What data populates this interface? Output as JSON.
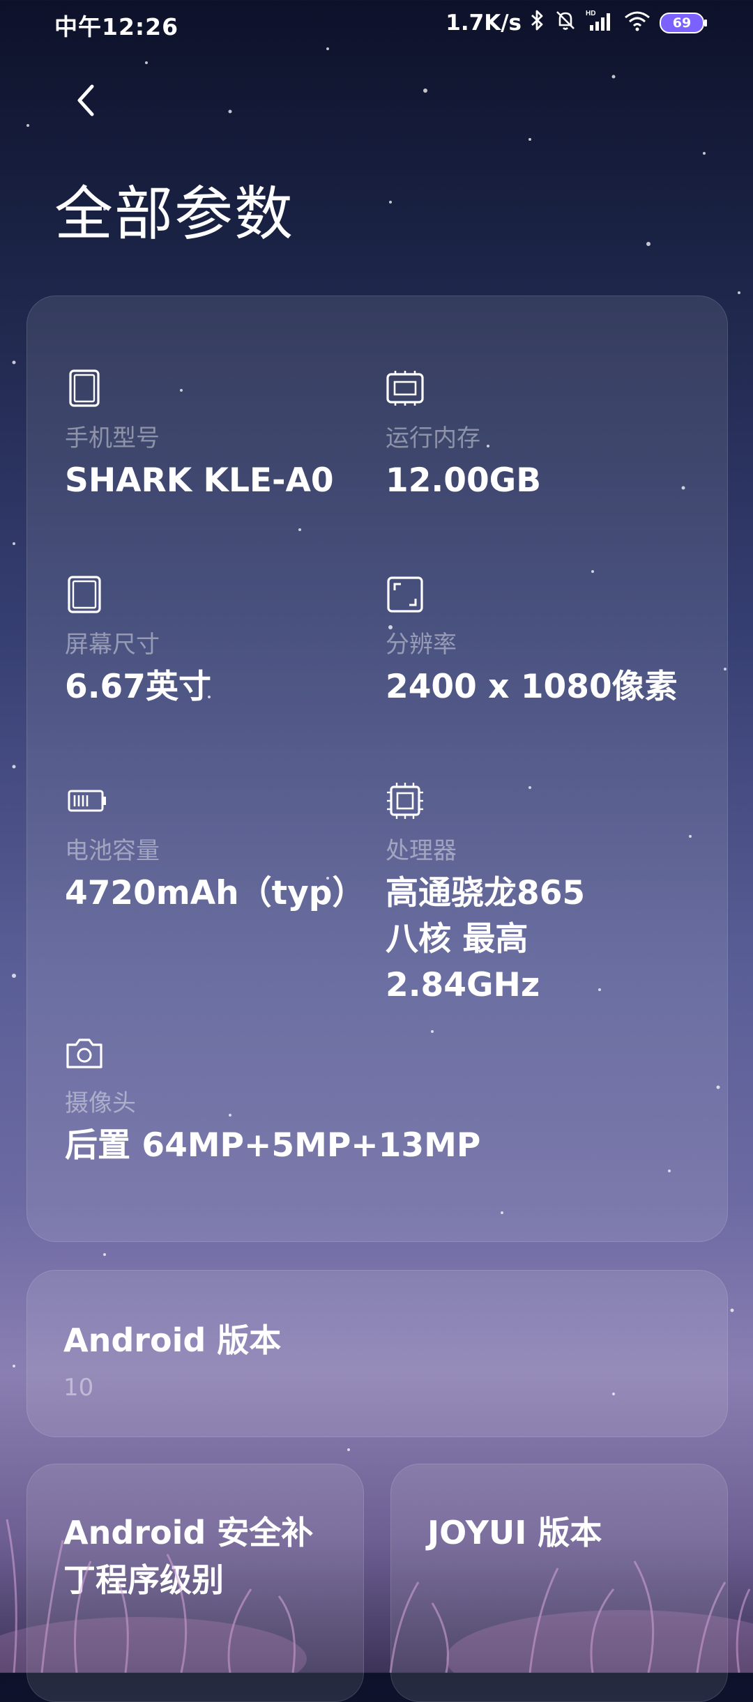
{
  "status_bar": {
    "time": "中午12:26",
    "network_speed": "1.7K/s",
    "battery_level": "69",
    "icons": [
      "bluetooth-icon",
      "mute-bell-icon",
      "hd-signal-icon",
      "wifi-icon",
      "battery-icon"
    ]
  },
  "header": {
    "back_icon": "chevron-left-icon",
    "title": "全部参数"
  },
  "specs": [
    {
      "icon": "phone-icon",
      "label": "手机型号",
      "value": "SHARK KLE-A0"
    },
    {
      "icon": "memory-chip-icon",
      "label": "运行内存",
      "value": "12.00GB"
    },
    {
      "icon": "screen-icon",
      "label": "屏幕尺寸",
      "value": "6.67英寸"
    },
    {
      "icon": "resolution-icon",
      "label": "分辨率",
      "value": "2400 x 1080像素"
    },
    {
      "icon": "battery-capacity-icon",
      "label": "电池容量",
      "value": "4720mAh（typ）"
    },
    {
      "icon": "processor-icon",
      "label": "处理器",
      "value_line1": "高通骁龙865",
      "value_line2": "八核 最高 2.84GHz"
    },
    {
      "icon": "camera-icon",
      "label": "摄像头",
      "value": "后置 64MP+5MP+13MP"
    }
  ],
  "android_version": {
    "title": "Android 版本",
    "value": "10"
  },
  "security_patch": {
    "title_line1": "Android 安全补",
    "title_line2": "丁程序级别"
  },
  "joyui_version": {
    "title": "JOYUI 版本"
  },
  "colors": {
    "accent_battery": "#7b61ff",
    "card_bg": "rgba(255,255,255,0.10)",
    "label": "rgba(255,255,255,0.42)"
  }
}
